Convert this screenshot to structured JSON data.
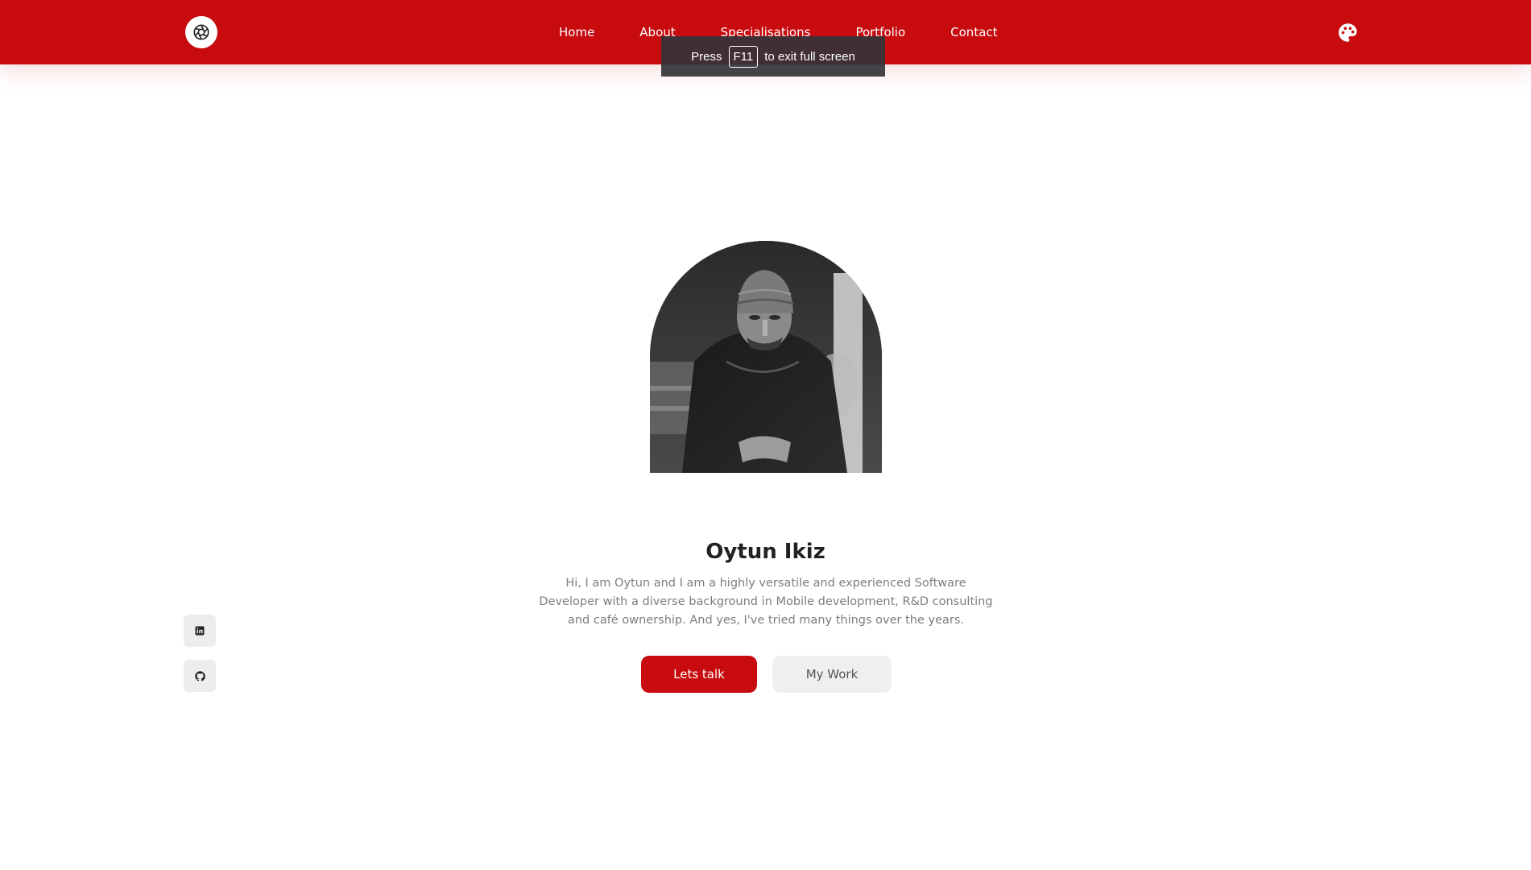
{
  "header": {
    "logo_icon": "aperture-logo-icon",
    "nav": [
      {
        "label": "Home"
      },
      {
        "label": "About"
      },
      {
        "label": "Specialisations"
      },
      {
        "label": "Portfolio"
      },
      {
        "label": "Contact"
      }
    ],
    "theme_icon": "palette-icon"
  },
  "fullscreen_notice": {
    "prefix": "Press",
    "key": "F11",
    "suffix": "to exit full screen"
  },
  "hero": {
    "name": "Oytun Ikiz",
    "bio": "Hi, I am Oytun and I am a highly versatile and experienced Software Developer with a diverse background in Mobile development, R&D consulting and café ownership. And yes, I've tried many things over the years.",
    "primary_button": "Lets talk",
    "secondary_button": "My Work"
  },
  "social": [
    {
      "icon": "linkedin-icon"
    },
    {
      "icon": "github-icon"
    }
  ],
  "colors": {
    "accent": "#c70b0f",
    "text_dark": "#222222",
    "text_muted": "#7d7d7d",
    "button_secondary_bg": "#efefef"
  }
}
